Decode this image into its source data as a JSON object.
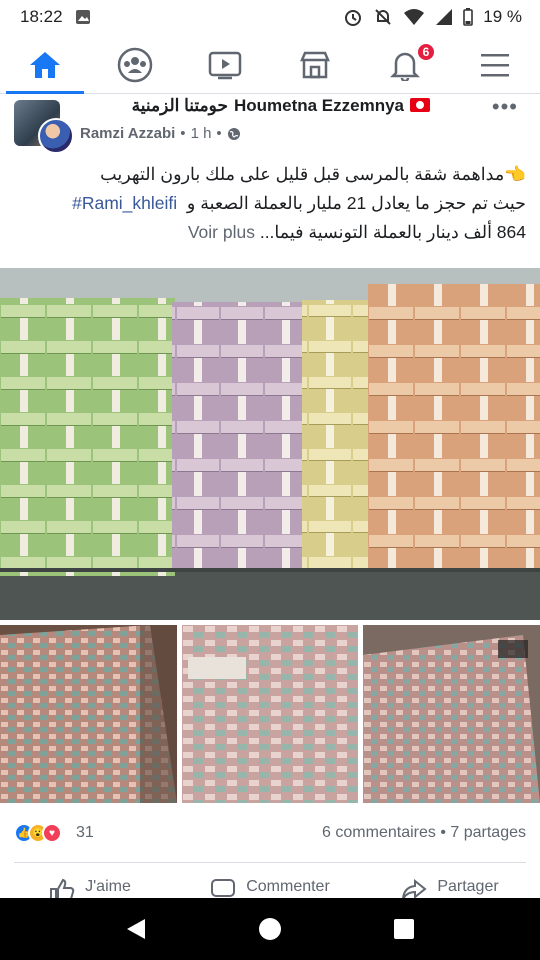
{
  "status_bar": {
    "time": "18:22",
    "battery": "19 %",
    "icons_left": [
      "image-icon"
    ],
    "icons_right": [
      "alarm-icon",
      "mute-icon",
      "wifi-icon",
      "signal-icon",
      "battery-icon"
    ]
  },
  "nav": {
    "items": [
      {
        "name": "home",
        "icon": "home-icon",
        "active": true
      },
      {
        "name": "groups",
        "icon": "groups-icon"
      },
      {
        "name": "watch",
        "icon": "video-icon"
      },
      {
        "name": "marketplace",
        "icon": "shop-icon"
      },
      {
        "name": "notifications",
        "icon": "bell-icon",
        "badge": "6"
      },
      {
        "name": "menu",
        "icon": "hamburger-icon"
      }
    ],
    "accent": "#1877f2",
    "badge_color": "#e41e3f"
  },
  "post": {
    "group_name_ar": "حومتنا الزمنية",
    "page_name": "Houmetna Ezzemnya",
    "author": "Ramzi Azzabi",
    "time": "1 h",
    "separator": "•",
    "text_line1": "👈مداهمة شقة بالمرسى قبل قليل على ملك بارون التهريب",
    "hashtag": "#Rami_khleifi",
    "text_line2": "حيث تم حجز ما يعادل 21 مليار بالعملة الصعبة و",
    "text_line3": "864 ألف دينار بالعملة التونسية فيما...",
    "see_more": "Voir plus"
  },
  "reactions": {
    "types": [
      "like",
      "wow",
      "love"
    ],
    "count": "31",
    "comments": "6 commentaires",
    "shares": "7 partages",
    "dot": "•"
  },
  "actions": {
    "like": "J'aime",
    "comment": "Commenter",
    "share": "Partager"
  },
  "colors": {
    "link": "#385898",
    "secondary_text": "#606770",
    "divider": "#dadde1"
  }
}
